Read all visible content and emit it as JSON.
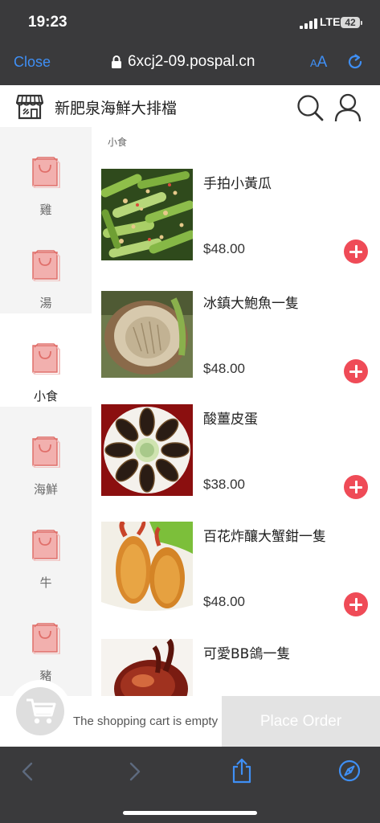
{
  "status_bar": {
    "time": "19:23",
    "network": "LTE",
    "battery": "42"
  },
  "browser": {
    "close_label": "Close",
    "url": "6xcj2-09.pospal.cn",
    "text_size_small": "A",
    "text_size_large": "A"
  },
  "header": {
    "store_name": "新肥泉海鮮大排檔"
  },
  "sidebar": {
    "categories": [
      {
        "label": "雞",
        "active": false
      },
      {
        "label": "湯",
        "active": false
      },
      {
        "label": "小食",
        "active": true
      },
      {
        "label": "海鮮",
        "active": false
      },
      {
        "label": "牛",
        "active": false
      },
      {
        "label": "豬",
        "active": false
      }
    ]
  },
  "content": {
    "section_title": "小食",
    "items": [
      {
        "name": "手拍小黃瓜",
        "price": "$48.00"
      },
      {
        "name": "冰鎮大鮑魚一隻",
        "price": "$48.00"
      },
      {
        "name": "酸薑皮蛋",
        "price": "$38.00"
      },
      {
        "name": "百花炸釀大蟹鉗一隻",
        "price": "$48.00"
      },
      {
        "name": "可愛BB鴿一隻",
        "price": ""
      }
    ]
  },
  "cart": {
    "empty_text": "The shopping cart is empty",
    "place_order_label": "Place Order"
  },
  "colors": {
    "accent_red": "#ef4b57",
    "ios_blue": "#3f8ff5",
    "bar_dark": "#3a3a3c",
    "sidebar_bg": "#f4f4f4"
  }
}
